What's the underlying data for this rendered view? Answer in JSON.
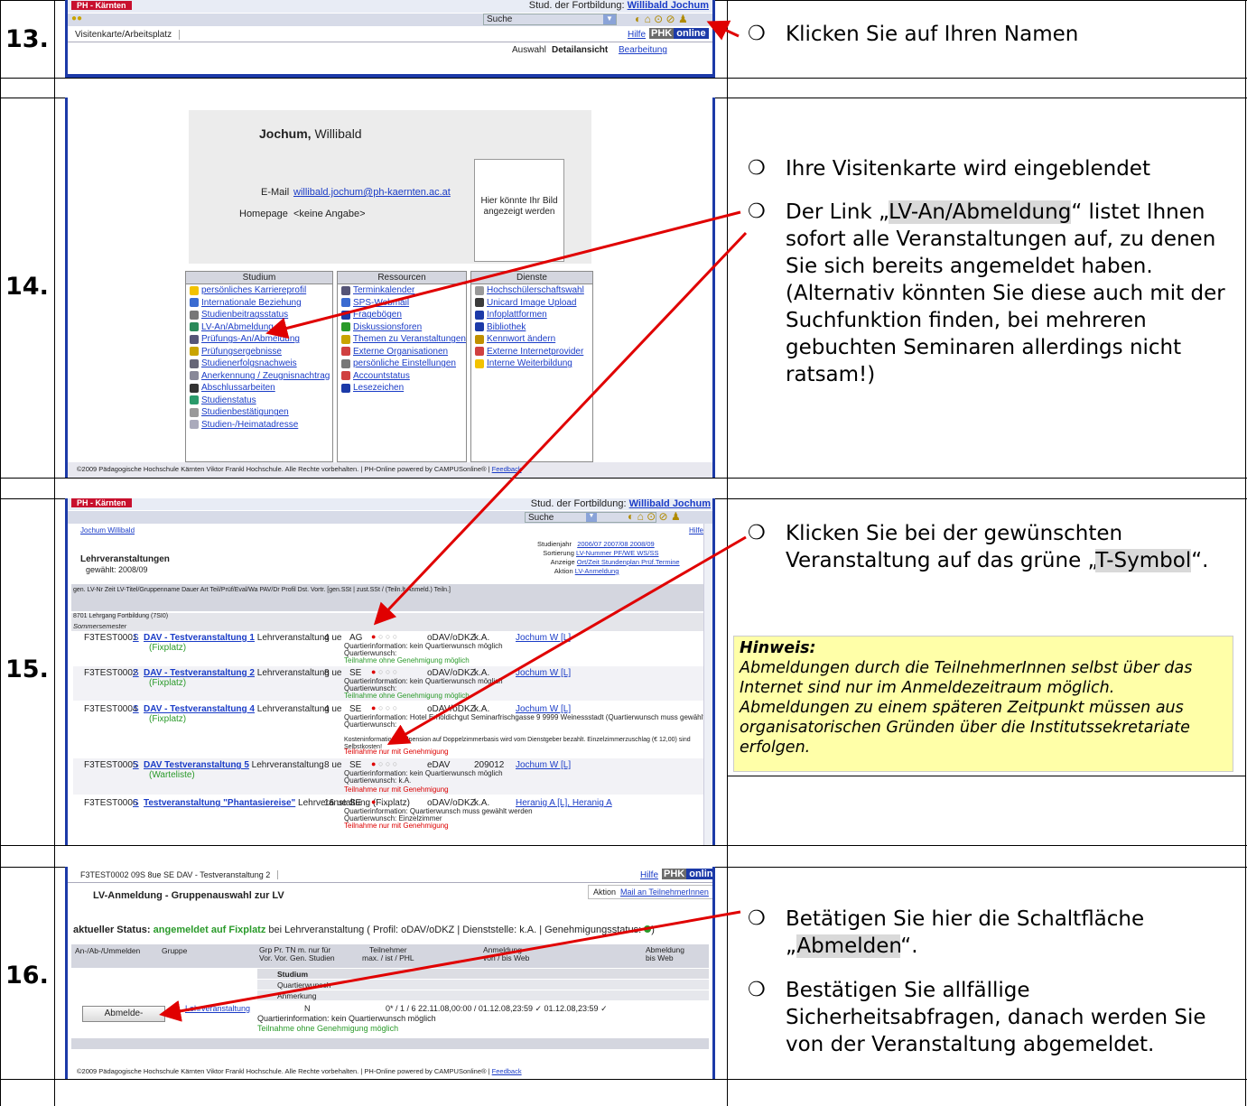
{
  "steps": [
    {
      "number": "13.",
      "instructions": [
        "Klicken Sie auf Ihren Namen"
      ]
    },
    {
      "number": "14.",
      "instructions": [
        "Ihre Visitenkarte wird eingeblendet"
      ]
    },
    {
      "number": "15.",
      "instructions": []
    },
    {
      "number": "16.",
      "instructions": []
    }
  ],
  "step13": {
    "logo": "PH - Kärnten",
    "user_prefix": "Stud. der Fortbildung:",
    "user_name": "Willibald Jochum",
    "search_label": "Suche",
    "tab": "Visitenkarte/Arbeitsplatz",
    "hilfe": "Hilfe",
    "phk": "PHK",
    "online": "online",
    "auswahl": "Auswahl",
    "detail": "Detailansicht",
    "bearbeitung": "Bearbeitung",
    "instruction": "Klicken Sie auf Ihren Namen"
  },
  "step14": {
    "name_bold": "Jochum,",
    "name_rest": " Willibald",
    "email_label": "E-Mail",
    "email": "willibald.jochum@ph-kaernten.ac.at",
    "homepage_label": "Homepage",
    "homepage": "<keine Angabe>",
    "photo": "Hier könnte Ihr Bild angezeigt werden",
    "studium_title": "Studium",
    "studium": [
      "persönliches Karriereprofil",
      "Internationale Beziehung",
      "Studienbeitragsstatus",
      "LV-An/Abmeldung",
      "Prüfungs-An/Abmeldung",
      "Prüfungsergebnisse",
      "Studienerfolgsnachweis",
      "Anerkennung / Zeugnisnachtrag",
      "Abschlussarbeiten",
      "Studienstatus",
      "Studienbestätigungen",
      "Studien-/Heimatadresse"
    ],
    "ressourcen_title": "Ressourcen",
    "ressourcen": [
      "Terminkalender",
      "SPS-Webmail",
      "Fragebögen",
      "Diskussionsforen",
      "Themen zu Veranstaltungen",
      "Externe Organisationen",
      "persönliche Einstellungen",
      "Accountstatus",
      "Lesezeichen"
    ],
    "dienste_title": "Dienste",
    "dienste": [
      "Hochschülerschaftswahl",
      "Unicard Image Upload",
      "Infoplattformen",
      "Bibliothek",
      "Kennwort ändern",
      "Externe Internetprovider",
      "Interne Weiterbildung"
    ],
    "footer": "©2009 Pädagogische Hochschule Kärnten Viktor Frankl Hochschule. Alle Rechte vorbehalten. | PH-Online powered by CAMPUSonline® |",
    "feedback": "Feedback",
    "bullet1": "Ihre Visitenkarte wird eingeblendet",
    "bullet2_pre": "Der Link „",
    "bullet2_hl": "LV-An/Abmeldung",
    "bullet2_post": "“ listet Ihnen sofort alle Veranstaltungen auf, zu denen Sie sich bereits angemeldet haben. (Alternativ könnten Sie diese auch mit der Suchfunktion finden, bei mehreren gebuchten Seminaren allerdings nicht ratsam!)"
  },
  "step15": {
    "logo": "PH - Kärnten",
    "user_prefix": "Stud. der Fortbildung:",
    "user_name": "Willibald Jochum",
    "search_label": "Suche",
    "tab": "Jochum Willibald",
    "hilfe": "Hilfe",
    "title": "Lehrveranstaltungen",
    "subtitle": "gewählt: 2008/09",
    "studienjahr_label": "Studienjahr",
    "years": "2006/07  2007/08  2008/09",
    "sortierung_label": "Sortierung",
    "sortierung": "LV-Nummer  PF/WE  WS/SS",
    "anzeige_label": "Anzeige",
    "anzeige": "Ort/Zeit  Stundenplan  Prüf.Termine",
    "aktion_label": "Aktion",
    "aktion": "LV-Anmeldung",
    "header": "gen. LV-Nr    Zeit LV-Titel/Gruppenname          Dauer  Art  Teil/Prüf/Eval/Wa  PAV/Dr  Profil   Dst.   Vortr. [gen.SSt | zust.SSt / (Teiln.lt.Anmeld.) Teiln.]",
    "group": "8701 Lehrgang Fortbildung (7SI0)",
    "semester": "Sommersemester",
    "rows": [
      {
        "nr": "F3TEST0001",
        "s": "S",
        "title": "DAV - Testveranstaltung 1",
        "type": "Lehrveranstaltung",
        "sub": "(Fixplatz)",
        "dauer": "4 ue",
        "art": "AG",
        "profil": "oDAV/oDKZ",
        "dst": "k.A.",
        "vortr": "Jochum W [L]",
        "info": "Quartierinformation: kein Quartierwunsch möglich",
        "wunsch": "Quartierwunsch:",
        "status": "Teilnahme ohne Genehmigung möglich"
      },
      {
        "nr": "F3TEST0002",
        "s": "S",
        "title": "DAV - Testveranstaltung 2",
        "type": "Lehrveranstaltung",
        "sub": "(Fixplatz)",
        "dauer": "8 ue",
        "art": "SE",
        "profil": "oDAV/oDKZ",
        "dst": "k.A.",
        "vortr": "Jochum W [L]",
        "info": "Quartierinformation: kein Quartierwunsch möglich",
        "wunsch": "Quartierwunsch:",
        "status": "Teilnahme ohne Genehmigung möglich"
      },
      {
        "nr": "F3TEST0004",
        "s": "S",
        "title": "DAV - Testveranstaltung 4",
        "type": "Lehrveranstaltung",
        "sub": "(Fixplatz)",
        "dauer": "4 ue",
        "art": "SE",
        "profil": "oDAV/oDKZ",
        "dst": "k.A.",
        "vortr": "Jochum W [L]",
        "info": "Quartierinformation: Hotel Erholdichgut Seminarfrischgasse 9 9999 Weinessstadt (Quartierwunsch muss gewählt werden)",
        "wunsch": "Quartierwunsch:",
        "status": "Teilnahme nur mit Genehmigung"
      },
      {
        "nr": "F3TEST0005",
        "s": "S",
        "title": "DAV Testveranstaltung 5",
        "type": "Lehrveranstaltung",
        "sub": "(Warteliste)",
        "dauer": "8 ue",
        "art": "SE",
        "profil": "eDAV",
        "dst": "209012",
        "vortr": "Jochum W [L]",
        "info": "Quartierinformation: kein Quartierwunsch möglich",
        "wunsch": "Quartierwunsch: k.A.",
        "status": "Teilnahme nur mit Genehmigung"
      },
      {
        "nr": "F3TEST0006",
        "s": "S",
        "title": "Testveranstaltung \"Phantasiereise\"",
        "type": "Lehrveranstaltung (Fixplatz)",
        "sub": "",
        "dauer": "16 ue",
        "art": "SE",
        "profil": "oDAV/oDKZ",
        "dst": "k.A.",
        "vortr": "Heranig A [L], Heranig A",
        "info": "Quartierinformation: Quartierwunsch muss gewählt werden",
        "wunsch": "Quartierwunsch: Einzelzimmer",
        "status": "Teilnahme nur mit Genehmigung"
      }
    ],
    "extra_cost": "Kosteninformation: Vollpension auf Doppelzimmerbasis wird vom Dienstgeber bezahlt. Einzelzimmerzuschlag (€ 12,00) sind Selbstkosten!",
    "bullet_pre": "Klicken Sie bei der gewünschten Veranstaltung auf das grüne „",
    "bullet_hl": "T-Symbol",
    "bullet_post": "“.",
    "hint_title": "Hinweis:",
    "hint_body": "Abmeldungen durch die TeilnehmerInnen selbst über das Internet sind nur im Anmeldezeitraum möglich. Abmeldungen zu einem späteren Zeitpunkt müssen aus organisatorischen Gründen über die Institutssekretariate erfolgen."
  },
  "step16": {
    "tab": "F3TEST0002 09S 8ue SE DAV - Testveranstaltung 2",
    "hilfe": "Hilfe",
    "phk": "PHK",
    "online": "online",
    "title": "LV-Anmeldung - Gruppenauswahl zur LV",
    "aktion_label": "Aktion",
    "aktion": "Mail an TeilnehmerInnen",
    "status_pre": "aktueller Status:",
    "status_val": "angemeldet auf Fixplatz",
    "status_post": "bei Lehrveranstaltung ( Profil: oDAV/oDKZ | Dienststelle: k.A. | Genehmigungsstatus:",
    "col_an": "An-/Ab-/Ummelden",
    "col_gruppe": "Gruppe",
    "col_grp": "Grp Pr. TN m. nur für",
    "col_grp2": "Vor. Vor. Gen. Studien",
    "col_tn": "Teilnehmer",
    "col_tn2": "max. / ist / PHL",
    "col_anm": "Anmeldung",
    "col_anm2": "von   /   bis   Web",
    "col_abm": "Abmeldung",
    "col_abm2": "bis   Web",
    "studium": "Studium",
    "quartier": "Quartierwunsch",
    "anmerkung": "Anmerkung",
    "button": "Abmelde-",
    "group_link": "Lehrveranstaltung",
    "row_n": "N",
    "row_vals": "0* / 1 / 6   22.11.08,00:00  /  01.12.08,23:59  ✓    01.12.08,23:59  ✓",
    "row_info": "Quartierinformation: kein Quartierwunsch möglich",
    "row_status": "Teilnahme ohne Genehmigung möglich",
    "footer": "©2009 Pädagogische Hochschule Kärnten Viktor Frankl Hochschule. Alle Rechte vorbehalten. | PH-Online powered by CAMPUSonline® |",
    "feedback": "Feedback",
    "bullet1_pre": "Betätigen Sie hier die Schaltfläche „",
    "bullet1_hl": "Abmelden",
    "bullet1_post": "“.",
    "bullet2": "Bestätigen Sie allfällige Sicherheitsabfragen, danach werden Sie von der Veranstaltung abgemeldet."
  },
  "colors": {
    "accent_blue": "#1c3aa8",
    "arrow_red": "#e00000",
    "hint_yellow": "#ffffa8"
  }
}
